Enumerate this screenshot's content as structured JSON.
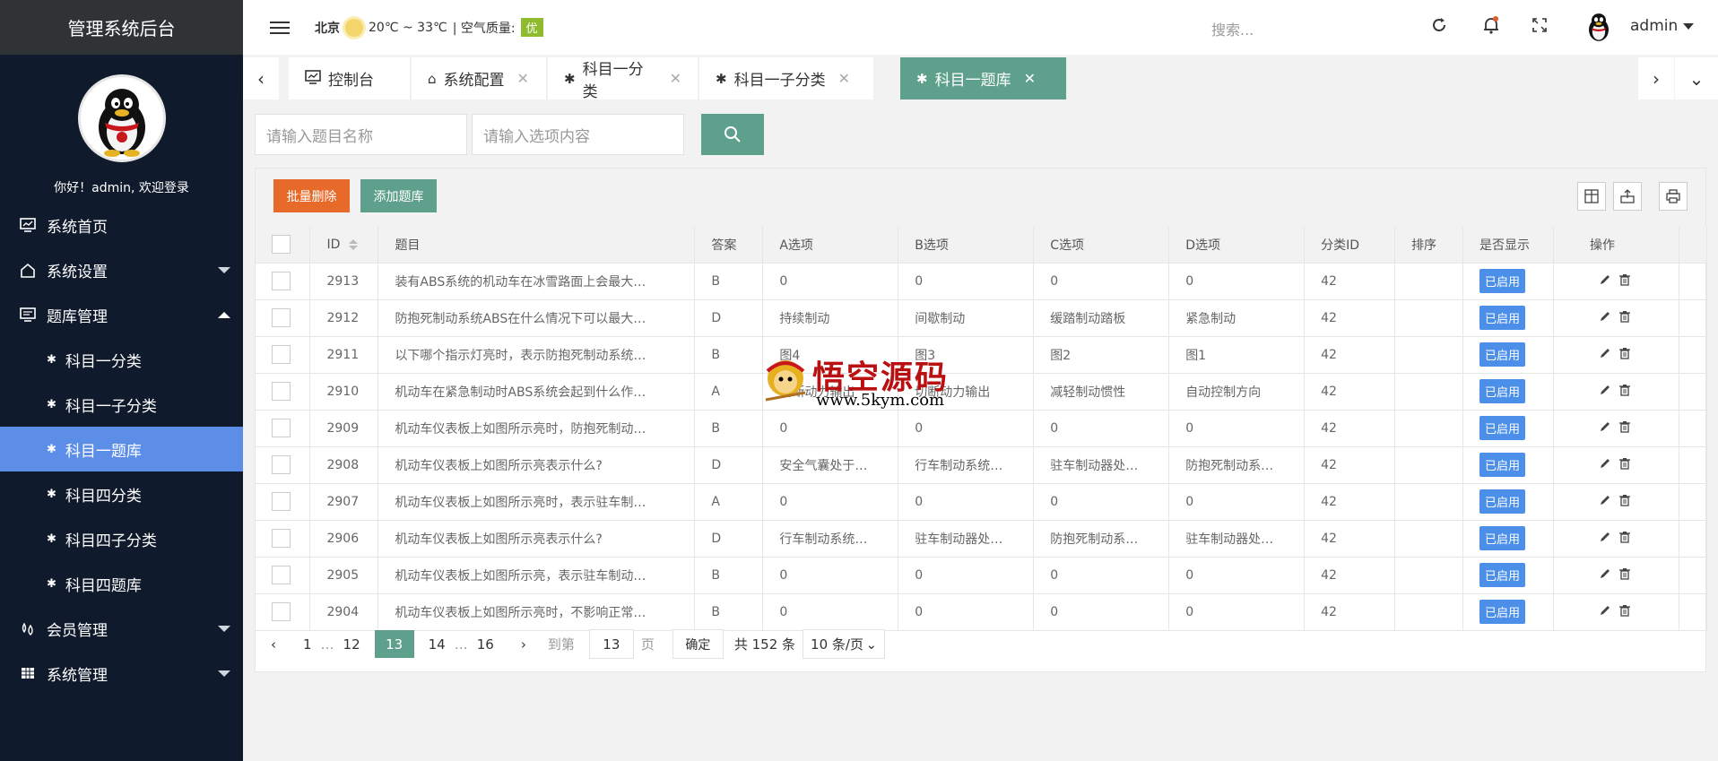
{
  "sidebar": {
    "title": "管理系统后台",
    "welcome": "你好！admin, 欢迎登录",
    "items": [
      {
        "label": "系统首页"
      },
      {
        "label": "系统设置"
      },
      {
        "label": "题库管理"
      },
      {
        "label": "会员管理"
      },
      {
        "label": "系统管理"
      }
    ],
    "subitems": [
      {
        "label": "科目一分类"
      },
      {
        "label": "科目一子分类"
      },
      {
        "label": "科目一题库"
      },
      {
        "label": "科目四分类"
      },
      {
        "label": "科目四子分类"
      },
      {
        "label": "科目四题库"
      }
    ]
  },
  "header": {
    "city": "北京",
    "temp": "20℃ ~ 33℃",
    "aq_label": "| 空气质量:",
    "aq_value": "优",
    "search_placeholder": "搜索...",
    "username": "admin"
  },
  "tabs": [
    {
      "label": "控制台"
    },
    {
      "label": "系统配置"
    },
    {
      "label": "科目一分类"
    },
    {
      "label": "科目一子分类"
    },
    {
      "label": "科目一题库"
    }
  ],
  "filters": {
    "title_placeholder": "请输入题目名称",
    "option_placeholder": "请输入选项内容"
  },
  "toolbar": {
    "batch_delete": "批量删除",
    "add_question": "添加题库"
  },
  "table": {
    "columns": [
      "ID",
      "题目",
      "答案",
      "A选项",
      "B选项",
      "C选项",
      "D选项",
      "分类ID",
      "排序",
      "是否显示",
      "操作"
    ],
    "status_label": "已启用",
    "rows": [
      {
        "id": "2913",
        "title": "装有ABS系统的机动车在冰雪路面上会最大…",
        "answer": "B",
        "a": "0",
        "b": "0",
        "c": "0",
        "d": "0",
        "cat": "42",
        "sort": ""
      },
      {
        "id": "2912",
        "title": "防抱死制动系统ABS在什么情况下可以最大…",
        "answer": "D",
        "a": "持续制动",
        "b": "间歇制动",
        "c": "缓踏制动踏板",
        "d": "紧急制动",
        "cat": "42",
        "sort": ""
      },
      {
        "id": "2911",
        "title": "以下哪个指示灯亮时，表示防抱死制动系统…",
        "answer": "B",
        "a": "图4",
        "b": "图3",
        "c": "图2",
        "d": "图1",
        "cat": "42",
        "sort": ""
      },
      {
        "id": "2910",
        "title": "机动车在紧急制动时ABS系统会起到什么作…",
        "answer": "A",
        "a": "切断动力输出",
        "b": "切断动力输出",
        "c": "减轻制动惯性",
        "d": "自动控制方向",
        "cat": "42",
        "sort": ""
      },
      {
        "id": "2909",
        "title": "机动车仪表板上如图所示亮时，防抱死制动…",
        "answer": "B",
        "a": "0",
        "b": "0",
        "c": "0",
        "d": "0",
        "cat": "42",
        "sort": ""
      },
      {
        "id": "2908",
        "title": "机动车仪表板上如图所示亮表示什么?",
        "answer": "D",
        "a": "安全气囊处于…",
        "b": "行车制动系统…",
        "c": "驻车制动器处…",
        "d": "防抱死制动系…",
        "cat": "42",
        "sort": ""
      },
      {
        "id": "2907",
        "title": "机动车仪表板上如图所示亮时，表示驻车制…",
        "answer": "A",
        "a": "0",
        "b": "0",
        "c": "0",
        "d": "0",
        "cat": "42",
        "sort": ""
      },
      {
        "id": "2906",
        "title": "机动车仪表板上如图所示亮表示什么?",
        "answer": "D",
        "a": "行车制动系统…",
        "b": "驻车制动器处…",
        "c": "防抱死制动系…",
        "d": "驻车制动器处…",
        "cat": "42",
        "sort": ""
      },
      {
        "id": "2905",
        "title": "机动车仪表板上如图所示亮，表示驻车制动…",
        "answer": "B",
        "a": "0",
        "b": "0",
        "c": "0",
        "d": "0",
        "cat": "42",
        "sort": ""
      },
      {
        "id": "2904",
        "title": "机动车仪表板上如图所示亮时，不影响正常…",
        "answer": "B",
        "a": "0",
        "b": "0",
        "c": "0",
        "d": "0",
        "cat": "42",
        "sort": ""
      }
    ]
  },
  "pagination": {
    "p1": "1",
    "ellipsis": "…",
    "p12": "12",
    "current": "13",
    "p14": "14",
    "p16": "16",
    "goto_label": "到第",
    "goto_value": "13",
    "page_unit": "页",
    "confirm": "确定",
    "total": "共 152 条",
    "page_size": "10 条/页"
  },
  "watermark": {
    "title": "悟空源码",
    "url": "www.5kym.com"
  },
  "colors": {
    "sidebar_bg": "#0f1a2c",
    "accent_green": "#5ea08b",
    "active_blue": "#5c8ee8",
    "danger_orange": "#e86a2b",
    "badge_blue": "#4b8fe8",
    "aq_green": "#8fbb2f"
  }
}
